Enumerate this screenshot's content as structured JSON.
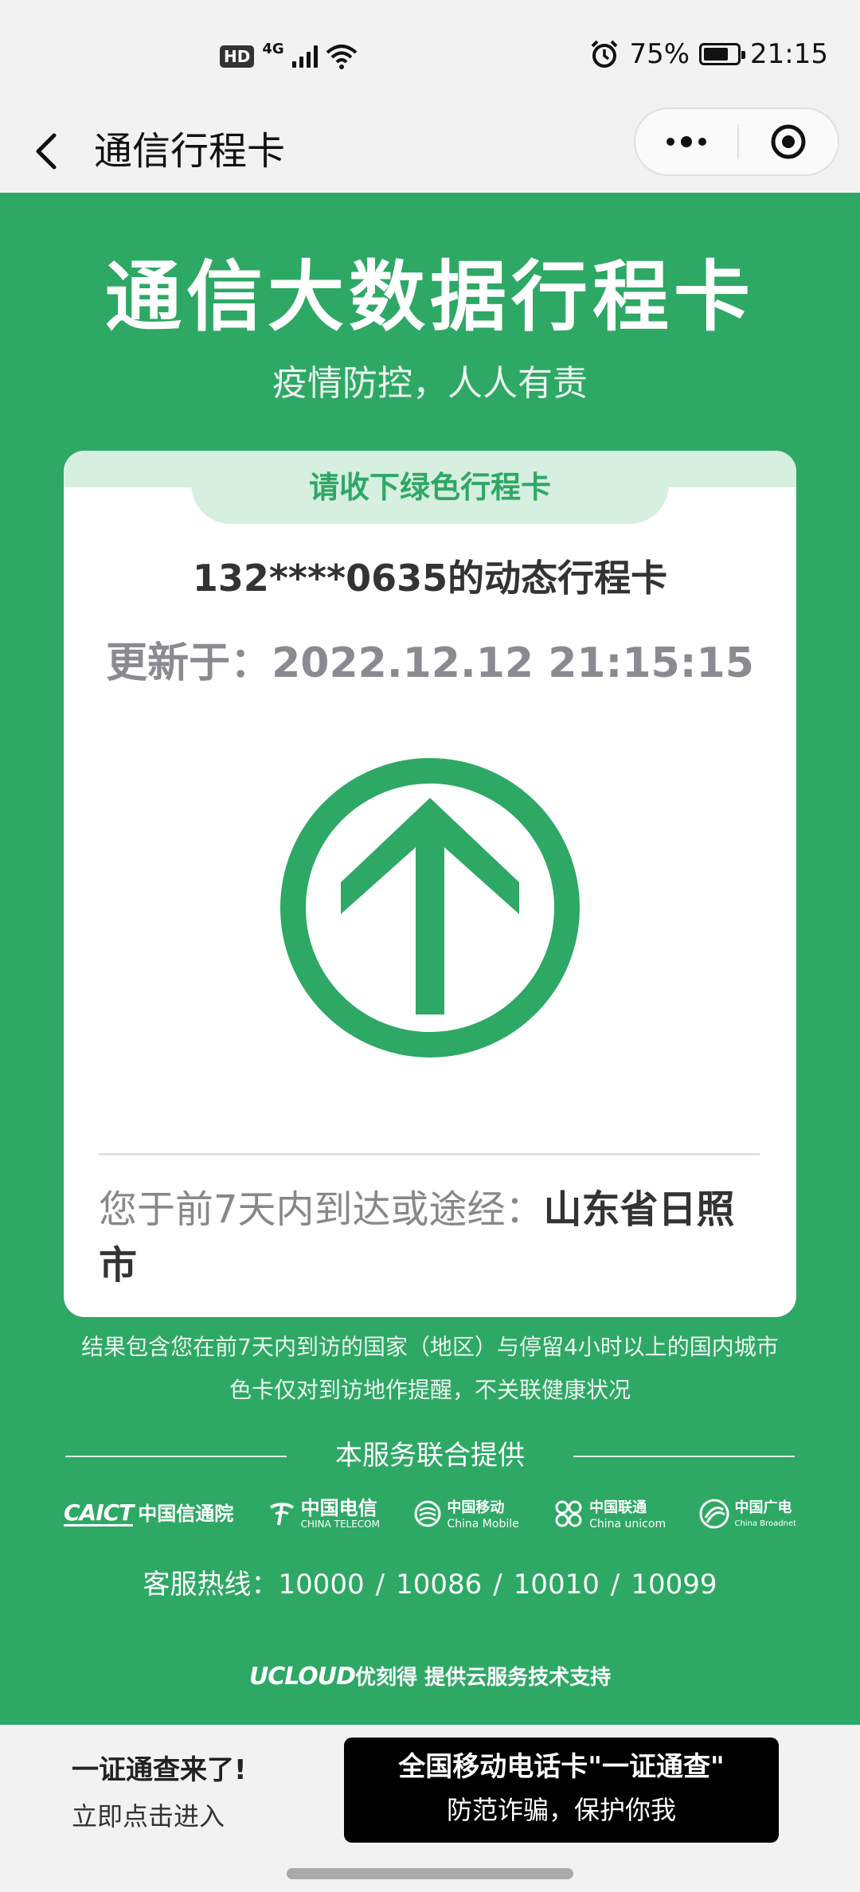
{
  "status_bar": {
    "hd": "HD",
    "network": "4G",
    "battery_text": "75%",
    "battery_level": 0.75,
    "time": "21:15"
  },
  "nav": {
    "title": "通信行程卡",
    "back_icon": "chevron-left-icon",
    "more_icon": "more-dots-icon",
    "close_icon": "target-icon"
  },
  "header": {
    "title": "通信大数据行程卡",
    "subtitle": "疫情防控，人人有责"
  },
  "card": {
    "tab_label": "请收下绿色行程卡",
    "phone_line": "132****0635的动态行程卡",
    "updated": "更新于：2022.12.12 21:15:15",
    "status_icon": "green-up-arrow-icon",
    "status_color": "#2ea865",
    "route_prefix": "您于前7天内到达或途经：",
    "route_places": "山东省日照市"
  },
  "notes": {
    "line1": "结果包含您在前7天内到访的国家（地区）与停留4小时以上的国内城市",
    "line2": "色卡仅对到访地作提醒，不关联健康状况"
  },
  "providers": {
    "heading": "本服务联合提供",
    "logos": [
      {
        "main": "CAICT",
        "sub": "中国信通院"
      },
      {
        "main": "中国电信",
        "sub": "CHINA TELECOM"
      },
      {
        "main": "中国移动",
        "sub": "China Mobile"
      },
      {
        "main": "中国联通",
        "sub": "China unicom"
      },
      {
        "main": "中国广电",
        "sub": "China Broadnet"
      }
    ]
  },
  "hotline": {
    "label": "客服热线：",
    "numbers": [
      "10000",
      "10086",
      "10010",
      "10099"
    ],
    "separator": "/"
  },
  "ucloud": {
    "brand": "UCLOUD",
    "text": "优刻得 提供云服务技术支持"
  },
  "promo": {
    "left_title": "一证通查来了!",
    "left_sub": "立即点击进入",
    "btn_line1": "全国移动电话卡\"一证通查\"",
    "btn_line2": "防范诈骗，保护你我"
  },
  "colors": {
    "brand_green": "#2ea865",
    "tab_bg": "#d6efe0"
  }
}
